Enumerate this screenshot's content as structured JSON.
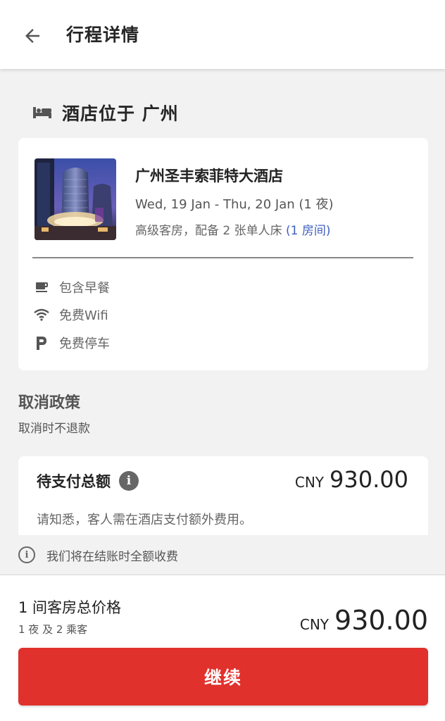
{
  "header": {
    "back_icon": "arrow-left-icon",
    "title": "行程详情"
  },
  "hotel_section": {
    "icon": "bed-icon",
    "title": "酒店位于 广州"
  },
  "hotel_card": {
    "photo": "hotel-photo",
    "name": "广州圣丰索菲特大酒店",
    "dates": "Wed, 19 Jan - Thu, 20 Jan (1 夜)",
    "room_desc": "高级客房，配备 2 张单人床 ",
    "rooms_link": "(1 房间)",
    "amenities": [
      {
        "icon": "coffee-cup-icon",
        "label": "包含早餐"
      },
      {
        "icon": "wifi-icon",
        "label": "免费Wifi"
      },
      {
        "icon": "parking-icon",
        "label": "免费停车"
      }
    ]
  },
  "cancellation": {
    "title": "取消政策",
    "text": "取消时不退款"
  },
  "amount_card": {
    "label": "待支付总额",
    "info_icon": "info-icon",
    "currency": "CNY",
    "amount": "930.00",
    "note": "请知悉，客人需在酒店支付额外费用。"
  },
  "info_line": {
    "icon": "info-outline-icon",
    "text": "我们将在结账时全额收费"
  },
  "bottom": {
    "total_label": "1 间客房总价格",
    "total_sub": "1 夜 及 2 乘客",
    "currency": "CNY",
    "amount": "930.00",
    "continue_label": "继续"
  },
  "colors": {
    "accent": "#e0312d",
    "link": "#3f5fbf",
    "background": "#f2f2f2"
  }
}
